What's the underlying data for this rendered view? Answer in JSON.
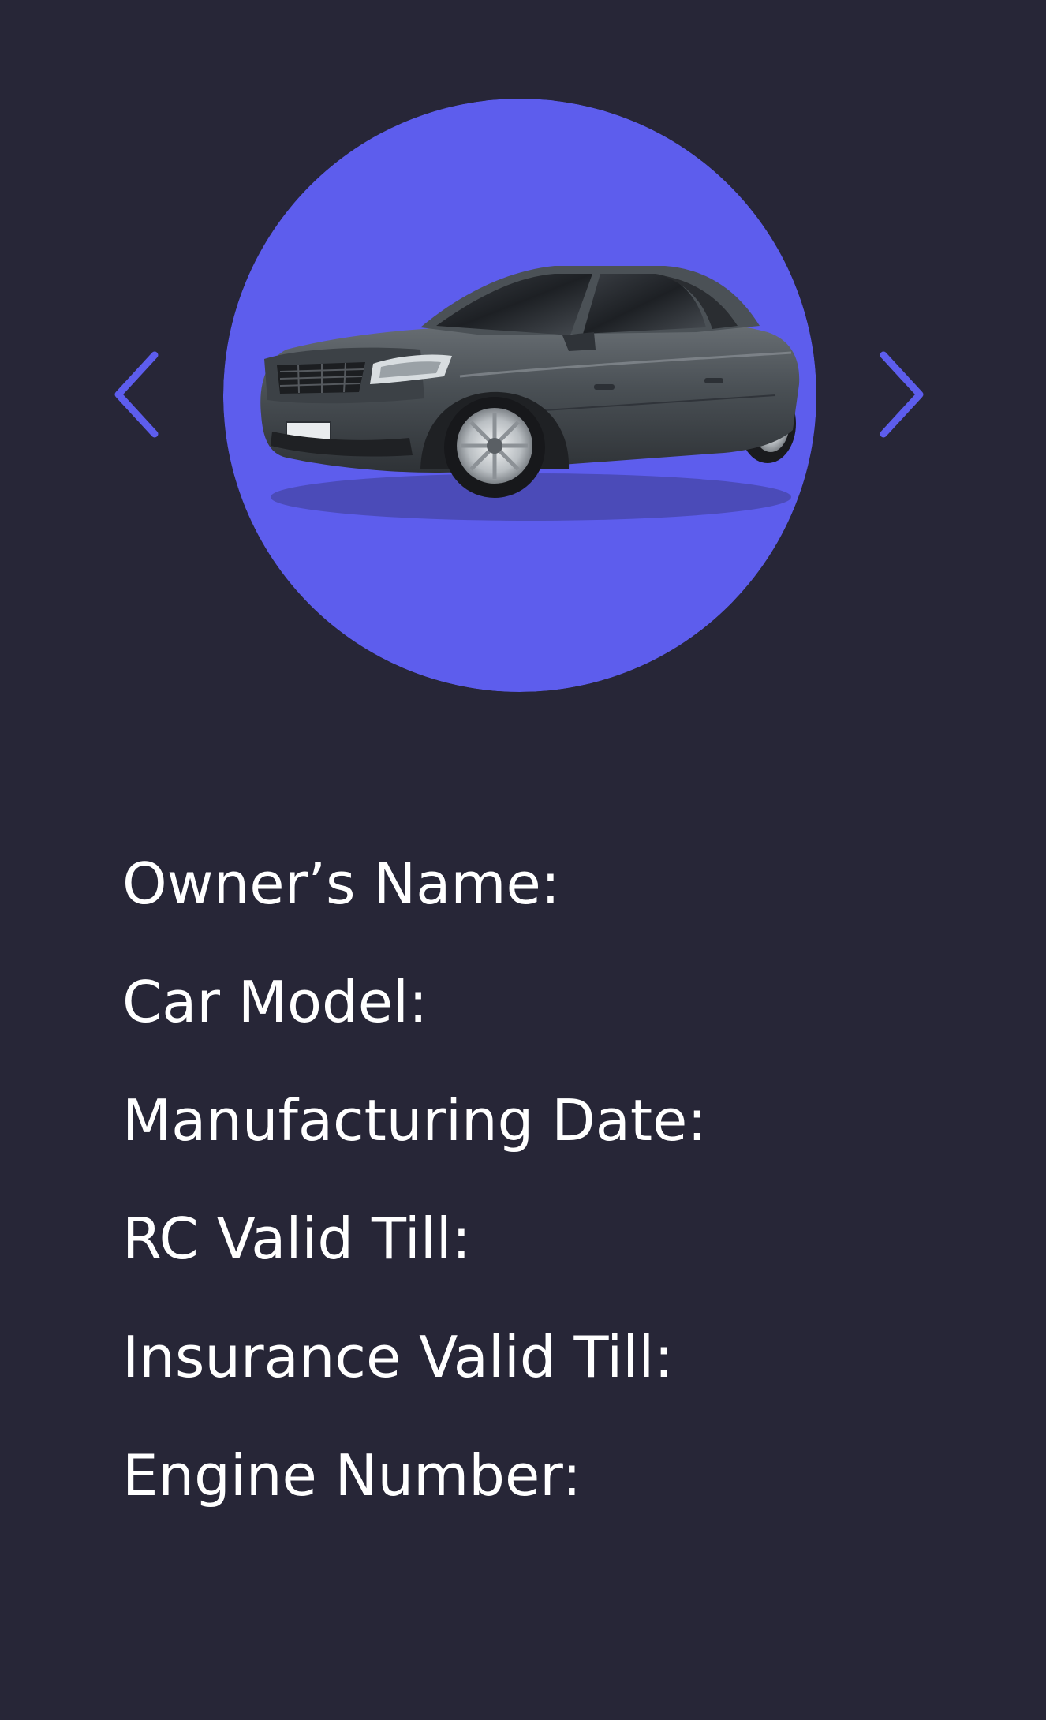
{
  "colors": {
    "background": "#272637",
    "accent": "#5d5ded",
    "text": "#ffffff"
  },
  "carousel": {
    "prev_icon": "chevron-left-icon",
    "next_icon": "chevron-right-icon",
    "image_icon": "car-sedan-icon"
  },
  "details": [
    {
      "label": "Owner’s Name:",
      "value": ""
    },
    {
      "label": "Car Model:",
      "value": ""
    },
    {
      "label": "Manufacturing Date:",
      "value": ""
    },
    {
      "label": "RC Valid Till:",
      "value": ""
    },
    {
      "label": "Insurance Valid Till:",
      "value": ""
    },
    {
      "label": "Engine Number:",
      "value": ""
    }
  ]
}
